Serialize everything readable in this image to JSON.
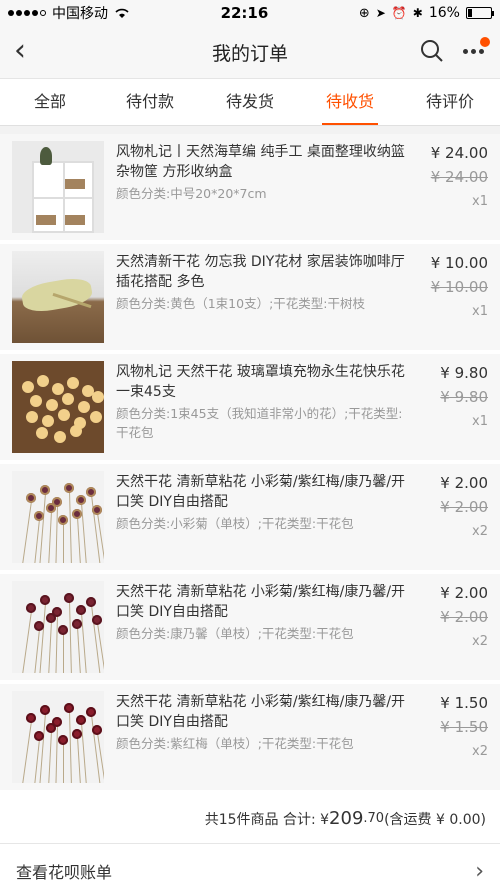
{
  "status_bar": {
    "carrier": "中国移动",
    "time": "22:16",
    "battery": "16%",
    "battery_level": 0.16
  },
  "nav": {
    "title": "我的订单"
  },
  "tabs": [
    {
      "label": "全部",
      "active": false
    },
    {
      "label": "待付款",
      "active": false
    },
    {
      "label": "待发货",
      "active": false
    },
    {
      "label": "待收货",
      "active": true
    },
    {
      "label": "待评价",
      "active": false
    }
  ],
  "items": [
    {
      "title": "风物札记丨天然海草编 纯手工 桌面整理收纳篮杂物筐 方形收纳盒",
      "spec": "颜色分类:中号20*20*7cm",
      "price": "¥ 24.00",
      "old_price": "¥ 24.00",
      "qty": "x1"
    },
    {
      "title": "天然清新干花 勿忘我 DIY花材 家居装饰咖啡厅插花搭配 多色",
      "spec": "颜色分类:黄色（1束10支）;干花类型:干树枝",
      "price": "¥ 10.00",
      "old_price": "¥ 10.00",
      "qty": "x1"
    },
    {
      "title": "风物札记 天然干花 玻璃罩填充物永生花快乐花 一束45支",
      "spec": "颜色分类:1束45支（我知道非常小的花）;干花类型:干花包",
      "price": "¥ 9.80",
      "old_price": "¥ 9.80",
      "qty": "x1"
    },
    {
      "title": "天然干花 清新草粘花 小彩菊/紫红梅/康乃馨/开口笑 DIY自由搭配",
      "spec": "颜色分类:小彩菊（单枝）;干花类型:干花包",
      "price": "¥ 2.00",
      "old_price": "¥ 2.00",
      "qty": "x2"
    },
    {
      "title": "天然干花 清新草粘花 小彩菊/紫红梅/康乃馨/开口笑 DIY自由搭配",
      "spec": "颜色分类:康乃馨（单枝）;干花类型:干花包",
      "price": "¥ 2.00",
      "old_price": "¥ 2.00",
      "qty": "x2"
    },
    {
      "title": "天然干花 清新草粘花 小彩菊/紫红梅/康乃馨/开口笑 DIY自由搭配",
      "spec": "颜色分类:紫红梅（单枝）;干花类型:干花包",
      "price": "¥ 1.50",
      "old_price": "¥ 1.50",
      "qty": "x2"
    }
  ],
  "summary": {
    "count_text": "共15件商品 合计: ¥ ",
    "total_int": "209",
    "total_dec": ".70",
    "shipping": " (含运费 ¥ 0.00)"
  },
  "footer": {
    "link_label": "查看花呗账单",
    "chevron": "›"
  },
  "colors": {
    "accent": "#ff5000"
  },
  "icons": [
    "back-arrow-icon",
    "search-icon",
    "more-icon",
    "wifi-icon",
    "chevron-right-icon"
  ]
}
